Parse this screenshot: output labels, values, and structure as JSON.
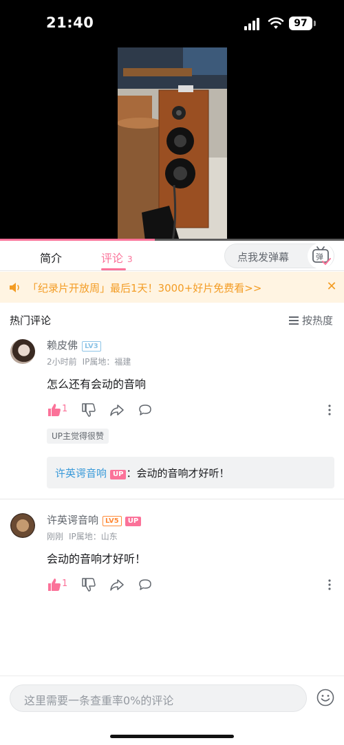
{
  "status_bar": {
    "time": "21:40",
    "battery": "97"
  },
  "video": {
    "progress": 0.45
  },
  "tabs": [
    {
      "label": "简介"
    },
    {
      "label": "评论",
      "count": "3"
    }
  ],
  "danmaku": {
    "placeholder": "点我发弹幕",
    "button_glyph": "弹"
  },
  "banner": {
    "text": "「纪录片开放周」最后1天！3000+好片免费看>>"
  },
  "section": {
    "title": "热门评论",
    "sort_label": "按热度"
  },
  "comments": [
    {
      "username": "赖皮佛",
      "level": "LV3",
      "time": "2小时前",
      "ip": "IP属地：福建",
      "text": "怎么还有会动的音响",
      "likes": "1",
      "up_liked": "UP主觉得很赞",
      "reply": {
        "name": "许英谔音响",
        "badge": "UP",
        "text": "：会动的音响才好听！"
      }
    },
    {
      "username": "许英谔音响",
      "level": "LV5",
      "badge": "UP",
      "time": "刚刚",
      "ip": "IP属地：山东",
      "text": "会动的音响才好听！",
      "likes": "1"
    }
  ],
  "composer": {
    "placeholder": "这里需要一条查重率0%的评论"
  },
  "colors": {
    "accent": "#fb7299",
    "banner_text": "#f39c24",
    "banner_bg": "#fff4e2",
    "reply_name": "#3a9ad9"
  }
}
